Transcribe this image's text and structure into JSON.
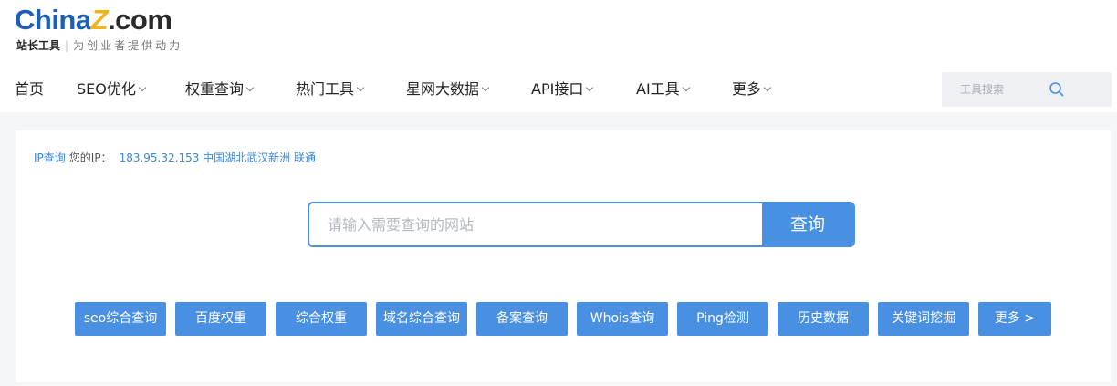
{
  "logo": {
    "china": "China",
    "z": "Z",
    "com": ".com",
    "sub_strong": "站长工具",
    "sub_sep": "|",
    "slogan": "为创业者提供动力"
  },
  "nav": {
    "items": [
      {
        "label": "首页",
        "dropdown": false
      },
      {
        "label": "SEO优化",
        "dropdown": true
      },
      {
        "label": "权重查询",
        "dropdown": true
      },
      {
        "label": "热门工具",
        "dropdown": true
      },
      {
        "label": "星网大数据",
        "dropdown": true
      },
      {
        "label": "API接口",
        "dropdown": true
      },
      {
        "label": "AI工具",
        "dropdown": true
      },
      {
        "label": "更多",
        "dropdown": true
      }
    ]
  },
  "tool_search": {
    "placeholder": "工具搜索",
    "icon": "search-icon"
  },
  "ip_info": {
    "link": "IP查询",
    "label": "您的IP：",
    "value": "183.95.32.153 中国湖北武汉新洲 联通"
  },
  "query": {
    "placeholder": "请输入需要查询的网站",
    "button": "查询"
  },
  "quick_buttons": [
    "seo综合查询",
    "百度权重",
    "综合权重",
    "域名综合查询",
    "备案查询",
    "Whois查询",
    "Ping检测",
    "历史数据",
    "关键词挖掘",
    "更多  >"
  ],
  "colors": {
    "accent": "#4a90e2",
    "logo_blue": "#1d5fb5",
    "logo_yellow": "#f0b31b",
    "background": "#f5f6f8"
  }
}
